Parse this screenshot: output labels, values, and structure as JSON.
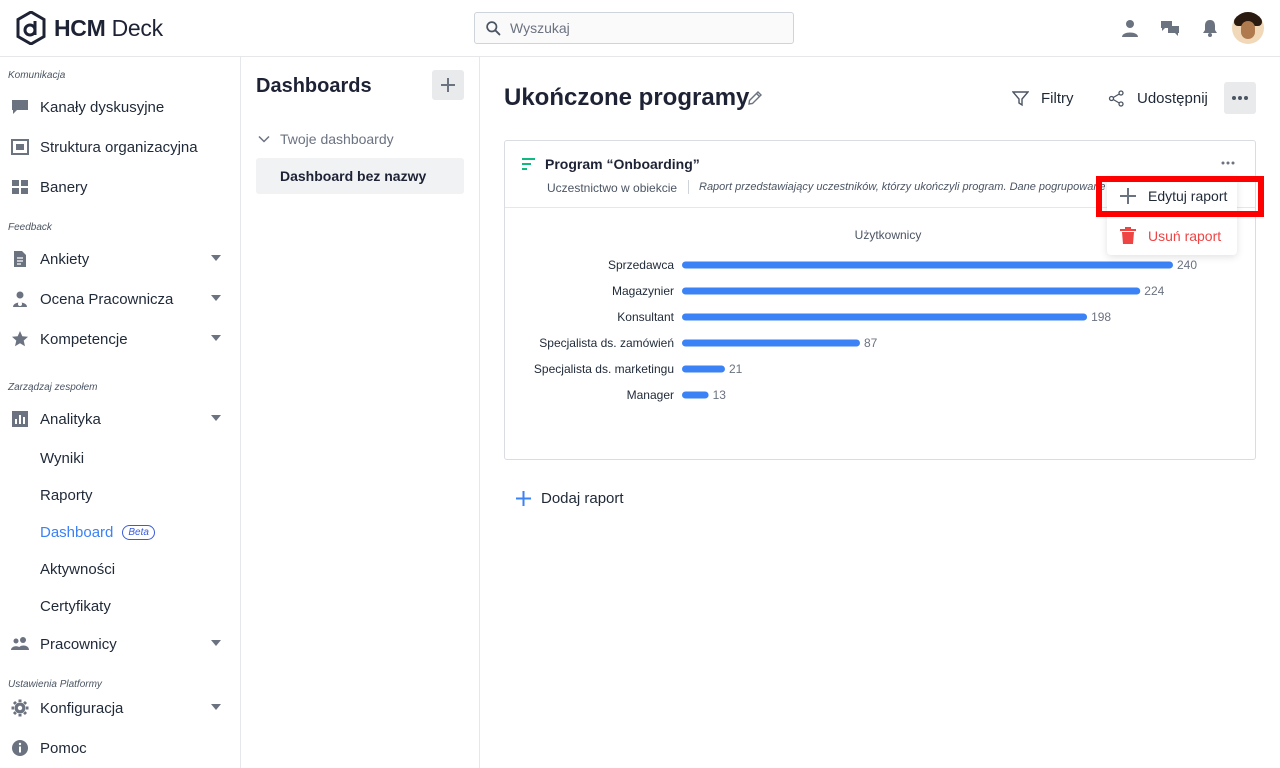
{
  "app": {
    "name_bold": "HCM",
    "name_rest": "Deck",
    "search_placeholder": "Wyszukaj"
  },
  "sidebar": {
    "sections": [
      {
        "label": "Komunikacja"
      },
      {
        "label": "Feedback"
      },
      {
        "label": "Zarządzaj zespołem"
      },
      {
        "label": "Ustawienia Platformy"
      }
    ],
    "items": [
      {
        "label": "Kanały dyskusyjne",
        "icon": "chat-bubble-icon"
      },
      {
        "label": "Struktura organizacyjna",
        "icon": "org-structure-icon"
      },
      {
        "label": "Banery",
        "icon": "grid-icon"
      },
      {
        "label": "Ankiety",
        "icon": "document-icon"
      },
      {
        "label": "Ocena Pracownicza",
        "icon": "person-rating-icon"
      },
      {
        "label": "Kompetencje",
        "icon": "star-icon"
      },
      {
        "label": "Analityka",
        "icon": "bar-chart-icon"
      },
      {
        "label": "Pracownicy",
        "icon": "people-icon"
      },
      {
        "label": "Konfiguracja",
        "icon": "gear-icon"
      },
      {
        "label": "Pomoc",
        "icon": "info-icon"
      }
    ],
    "analytics_sub": [
      {
        "label": "Wyniki"
      },
      {
        "label": "Raporty"
      },
      {
        "label": "Dashboard",
        "badge": "Beta"
      },
      {
        "label": "Aktywności"
      },
      {
        "label": "Certyfikaty"
      }
    ]
  },
  "dashboards": {
    "title": "Dashboards",
    "group_label": "Twoje dashboardy",
    "items": [
      {
        "label": "Dashboard bez nazwy"
      }
    ]
  },
  "main": {
    "title": "Ukończone programy",
    "filters_label": "Filtry",
    "share_label": "Udostępnij",
    "add_report_label": "Dodaj raport"
  },
  "report": {
    "title": "Program “Onboarding”",
    "subtitle": "Uczestnictwo w obiekcie",
    "description": "Raport przedstawiający uczestników, którzy ukończyli program. Dane pogrupowane",
    "accent": "#10b981"
  },
  "menu": {
    "edit_label": "Edytuj raport",
    "delete_label": "Usuń raport",
    "delete_color": "#ef4444"
  },
  "chart_data": {
    "type": "bar",
    "orientation": "horizontal",
    "title": "Użytkownicy",
    "categories": [
      "Sprzedawca",
      "Magazynier",
      "Konsultant",
      "Specjalista ds. zamówień",
      "Specjalista ds. marketingu",
      "Manager"
    ],
    "values": [
      240,
      224,
      198,
      87,
      21,
      13
    ],
    "color": "#3b82f6",
    "xlim": [
      0,
      240
    ],
    "grid": false,
    "legend": false
  },
  "colors": {
    "accent_blue": "#3b82f6",
    "highlight": "#ff0000"
  }
}
